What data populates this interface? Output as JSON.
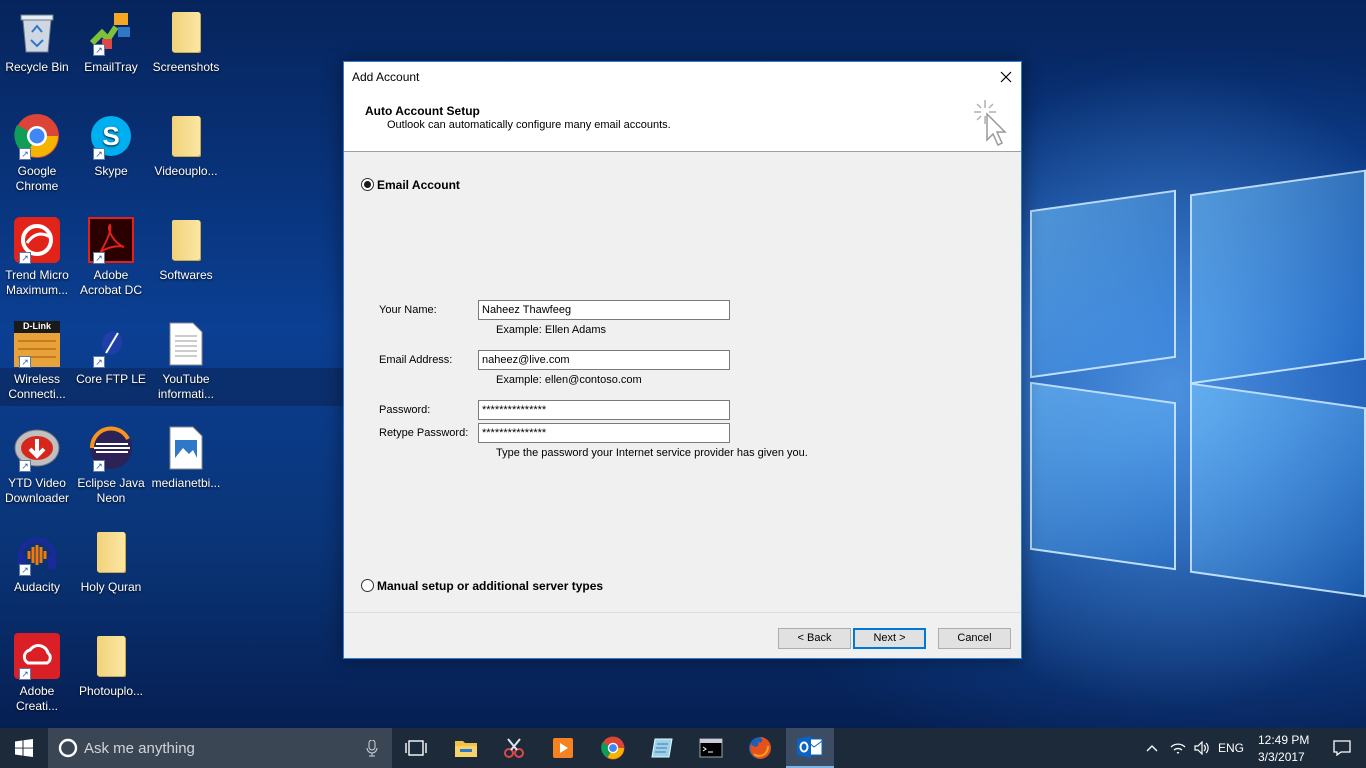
{
  "desktop": {
    "icons": [
      {
        "label": "Recycle Bin"
      },
      {
        "label": "EmailTray"
      },
      {
        "label": "Screenshots"
      },
      {
        "label": "Google Chrome"
      },
      {
        "label": "Skype"
      },
      {
        "label": "Videouplo..."
      },
      {
        "label": "Trend Micro Maximum..."
      },
      {
        "label": "Adobe Acrobat DC"
      },
      {
        "label": "Softwares"
      },
      {
        "label": "Wireless Connecti..."
      },
      {
        "label": "Core FTP LE"
      },
      {
        "label": "YouTube informati..."
      },
      {
        "label": "YTD Video Downloader"
      },
      {
        "label": "Eclipse Java Neon"
      },
      {
        "label": "medianetbi..."
      },
      {
        "label": "Audacity"
      },
      {
        "label": "Holy Quran"
      },
      {
        "label": "Adobe Creati..."
      },
      {
        "label": "Photouplo..."
      }
    ],
    "dlink_logo": "D-Link"
  },
  "dialog": {
    "title": "Add Account",
    "header_title": "Auto Account Setup",
    "header_subtitle": "Outlook can automatically configure many email accounts.",
    "email_account_label": "Email Account",
    "email_account_selected": true,
    "fields": {
      "name_label": "Your Name:",
      "name_value": "Naheez Thawfeeg",
      "name_hint": "Example: Ellen Adams",
      "email_label": "Email Address:",
      "email_value": "naheez@live.com",
      "email_hint": "Example: ellen@contoso.com",
      "password_label": "Password:",
      "password_value": "***************",
      "retype_label": "Retype Password:",
      "retype_value": "***************",
      "password_hint": "Type the password your Internet service provider has given you."
    },
    "manual_setup_label": "Manual setup or additional server types",
    "buttons": {
      "back": "< Back",
      "next": "Next >",
      "cancel": "Cancel"
    }
  },
  "taskbar": {
    "search_placeholder": "Ask me anything",
    "apps": [
      "task-view",
      "file-explorer",
      "snipping-tool",
      "media-player",
      "google-chrome",
      "notepad-app",
      "command-prompt",
      "firefox",
      "outlook"
    ],
    "active_app": "outlook",
    "language": "ENG",
    "time": "12:49 PM",
    "date": "3/3/2017"
  },
  "colors": {
    "accent": "#0078d7",
    "taskbar": "#1c2a3a",
    "dialog_bg": "#f0f0f0"
  }
}
